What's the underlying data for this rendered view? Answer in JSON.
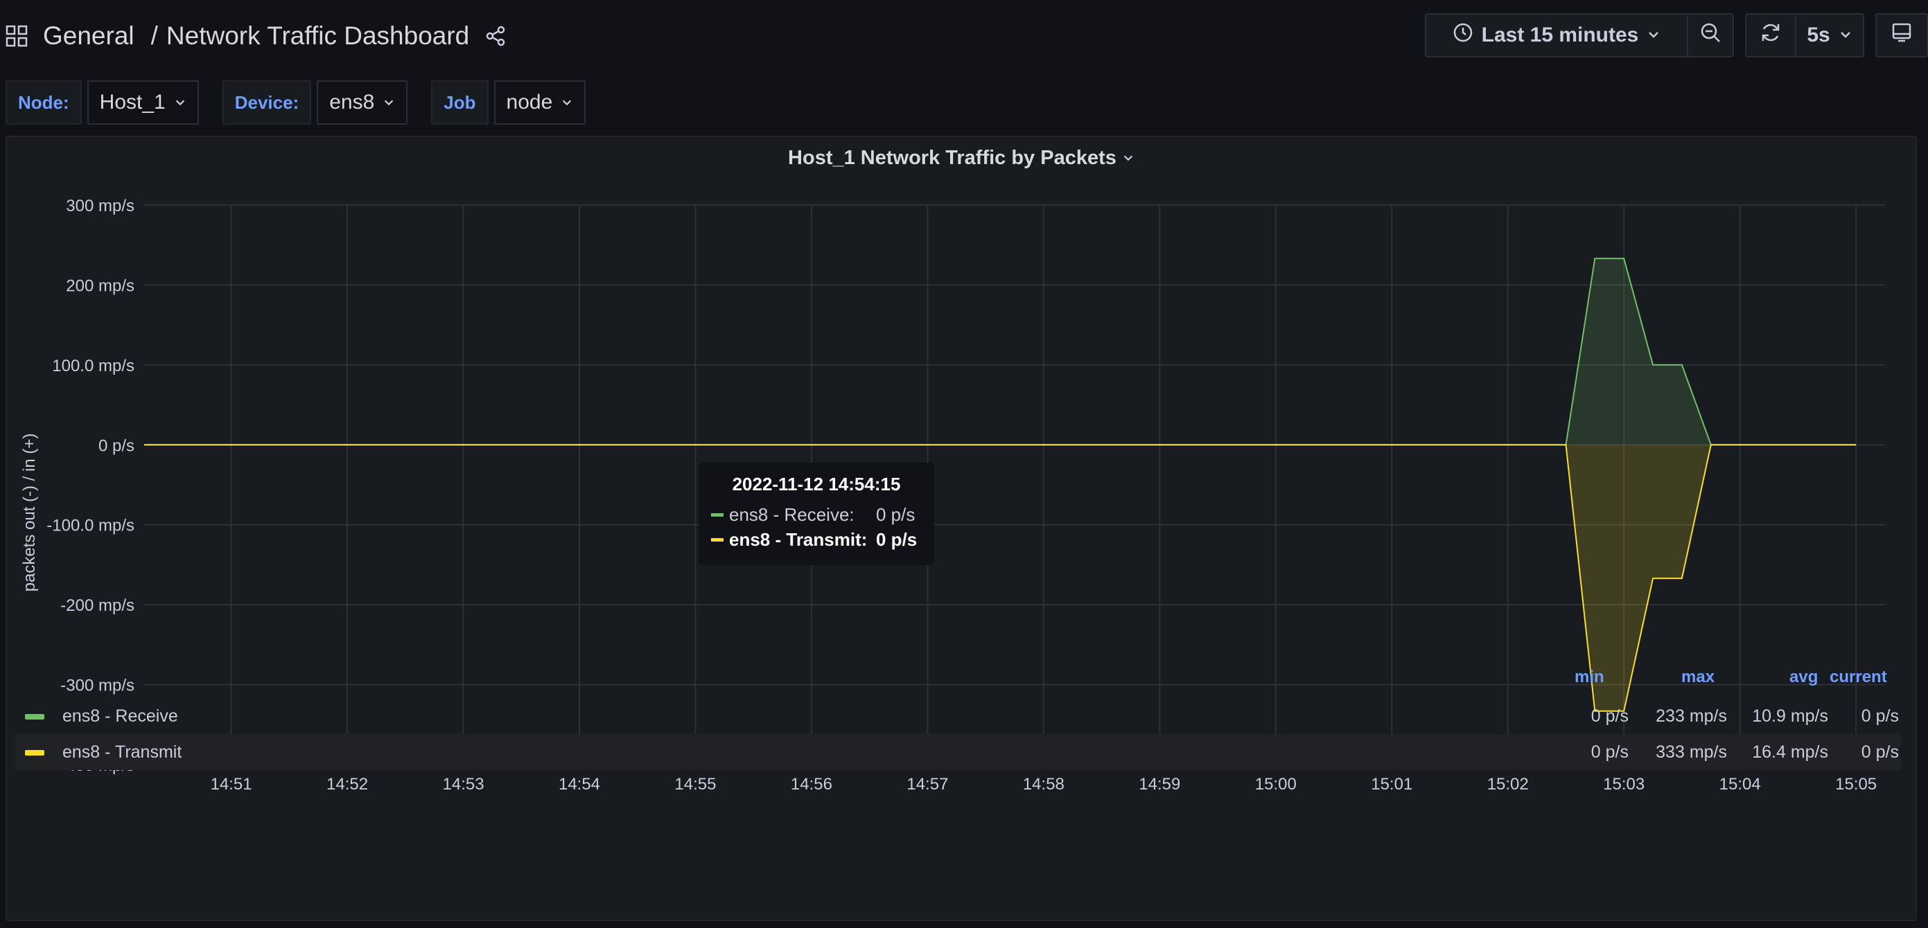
{
  "header": {
    "folder": "General",
    "separator": "/",
    "title": "Network Traffic Dashboard",
    "time_range": "Last 15 minutes",
    "refresh_interval": "5s"
  },
  "variables": [
    {
      "label": "Node:",
      "value": "Host_1"
    },
    {
      "label": "Device:",
      "value": "ens8"
    },
    {
      "label": "Job",
      "value": "node"
    }
  ],
  "panel": {
    "title": "Host_1 Network Traffic by Packets"
  },
  "tooltip": {
    "time": "2022-11-12 14:54:15",
    "rows": [
      {
        "name": "ens8 - Receive:",
        "value": "0 p/s"
      },
      {
        "name": "ens8 - Transmit:",
        "value": "0 p/s"
      }
    ]
  },
  "legend": {
    "headers": {
      "min": "min",
      "max": "max",
      "avg": "avg",
      "current": "current"
    },
    "rows": [
      {
        "name": "ens8 - Receive",
        "min": "0 p/s",
        "max": "233 mp/s",
        "avg": "10.9 mp/s",
        "current": "0 p/s"
      },
      {
        "name": "ens8 - Transmit",
        "min": "0 p/s",
        "max": "333 mp/s",
        "avg": "16.4 mp/s",
        "current": "0 p/s"
      }
    ]
  },
  "colors": {
    "receive": "#73bf69",
    "transmit": "#fade2a",
    "link": "#6e9fff",
    "background": "#111217",
    "panel": "#181b1f"
  },
  "chart_data": {
    "type": "area",
    "ylabel": "packets out (-) / in (+)",
    "ylim": [
      -400,
      300
    ],
    "ytick_labels": [
      "300 mp/s",
      "200 mp/s",
      "100.0 mp/s",
      "0 p/s",
      "-100.0 mp/s",
      "-200 mp/s",
      "-300 mp/s",
      "-400 mp/s"
    ],
    "ytick_values": [
      300,
      200,
      100,
      0,
      -100,
      -200,
      -300,
      -400
    ],
    "xlim": [
      "14:50:15",
      "15:05:15"
    ],
    "xtick_labels": [
      "14:51",
      "14:52",
      "14:53",
      "14:54",
      "14:55",
      "14:56",
      "14:57",
      "14:58",
      "14:59",
      "15:00",
      "15:01",
      "15:02",
      "15:03",
      "15:04",
      "15:05"
    ],
    "grid": true,
    "legend_position": "bottom",
    "series": [
      {
        "name": "ens8 - Receive",
        "color": "#73bf69",
        "x": [
          "14:50:15",
          "15:02:30",
          "15:02:45",
          "15:03:00",
          "15:03:15",
          "15:03:30",
          "15:03:45",
          "15:05:00"
        ],
        "y": [
          0,
          0,
          233,
          233,
          100,
          100,
          0,
          0
        ]
      },
      {
        "name": "ens8 - Transmit",
        "color": "#fade2a",
        "x": [
          "14:50:15",
          "15:02:30",
          "15:02:45",
          "15:03:00",
          "15:03:15",
          "15:03:30",
          "15:03:45",
          "15:05:00"
        ],
        "y": [
          0,
          0,
          -333,
          -333,
          -167,
          -167,
          0,
          0
        ]
      }
    ]
  }
}
